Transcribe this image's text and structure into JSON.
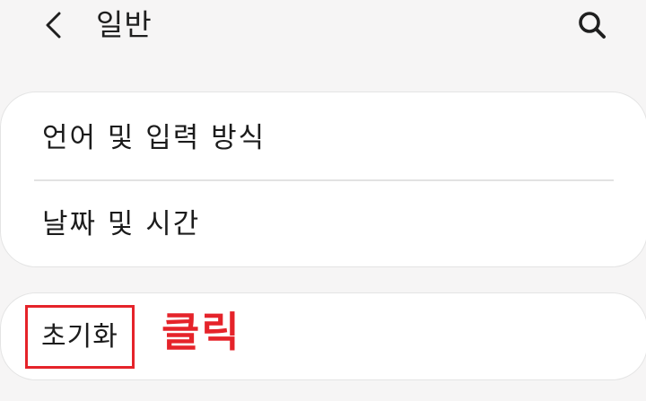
{
  "header": {
    "title": "일반",
    "back_icon": "chevron-left-icon",
    "search_icon": "search-icon"
  },
  "settings_group_1": {
    "items": [
      {
        "label": "언어 및 입력 방식"
      },
      {
        "label": "날짜 및 시간"
      }
    ]
  },
  "settings_group_2": {
    "items": [
      {
        "label": "초기화"
      }
    ]
  },
  "annotation": {
    "text": "클릭",
    "color": "#e5232a"
  },
  "colors": {
    "background": "#f6f5f5",
    "card": "#ffffff",
    "highlight": "#e5232a"
  }
}
